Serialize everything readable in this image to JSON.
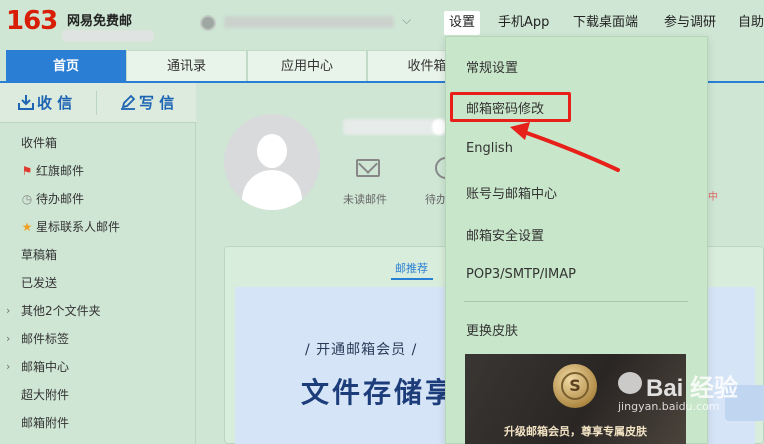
{
  "header": {
    "logo_number": "163",
    "logo_text": "网易免费邮",
    "account_chevron": "⌵",
    "nav": [
      {
        "label": "设置",
        "active": true
      },
      {
        "label": "手机App"
      },
      {
        "label": "下载桌面端"
      },
      {
        "label": "参与调研"
      },
      {
        "label": "自助"
      }
    ]
  },
  "tabs": [
    {
      "label": "首页",
      "active": true
    },
    {
      "label": "通讯录"
    },
    {
      "label": "应用中心"
    },
    {
      "label": "收件箱"
    }
  ],
  "sidebar": {
    "receive_label": "收 信",
    "write_label": "写 信",
    "folders": [
      {
        "label": "收件箱",
        "icon": ""
      },
      {
        "label": "红旗邮件",
        "icon": "flag-icon"
      },
      {
        "label": "待办邮件",
        "icon": "clock-icon"
      },
      {
        "label": "星标联系人邮件",
        "icon": "star-icon"
      },
      {
        "label": "草稿箱",
        "icon": ""
      },
      {
        "label": "已发送",
        "icon": ""
      },
      {
        "label": "其他2个文件夹",
        "icon": "",
        "expandable": true
      },
      {
        "label": "邮件标签",
        "icon": "",
        "expandable": true
      },
      {
        "label": "邮箱中心",
        "icon": "",
        "expandable": true
      },
      {
        "label": "超大附件",
        "icon": ""
      },
      {
        "label": "邮箱附件",
        "icon": ""
      }
    ]
  },
  "main": {
    "unread_label": "未读邮件",
    "todo_label": "待办",
    "recommend_tab": "邮推荐",
    "banner_subtitle": "/ 开通邮箱会员 /",
    "banner_title": "文件存储享"
  },
  "settings_menu": {
    "items": [
      {
        "label": "常规设置"
      },
      {
        "label": "邮箱密码修改",
        "highlighted": true
      },
      {
        "label": "English"
      },
      {
        "label": "账号与邮箱中心"
      },
      {
        "label": "邮箱安全设置"
      },
      {
        "label": "POP3/SMTP/IMAP"
      },
      {
        "label": "更换皮肤"
      }
    ],
    "banner_text": "升级邮箱会员，尊享专属皮肤",
    "coin_symbol": "S"
  },
  "watermark": {
    "text": "Bai 经验",
    "sub": "jingyan.baidu.com"
  },
  "colors": {
    "brand_red": "#d81e06",
    "accent_blue": "#2a7ed4",
    "background_green": "#cfe6d4",
    "highlight_red": "#e8201a"
  }
}
